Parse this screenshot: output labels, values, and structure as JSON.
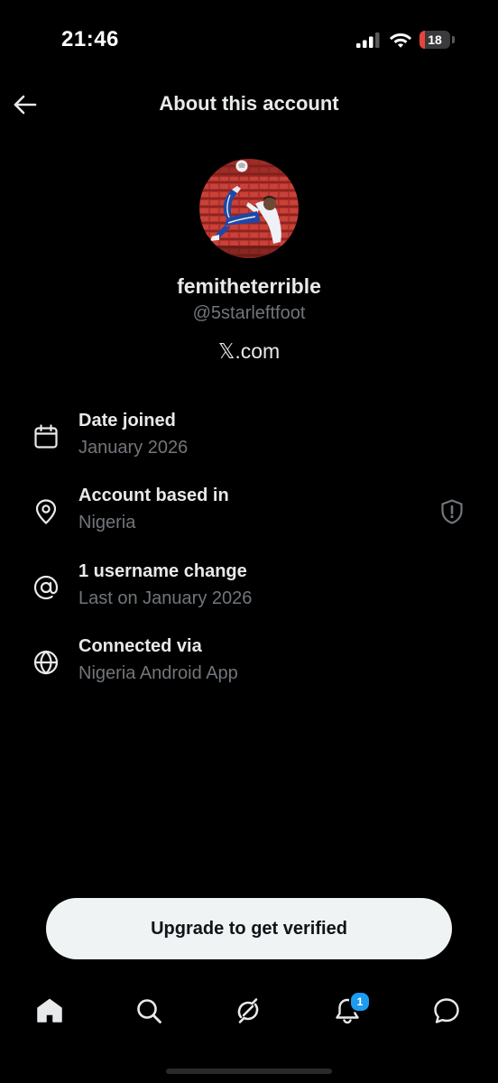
{
  "status_bar": {
    "time": "21:46",
    "battery_level": "18",
    "battery_fraction": 0.18
  },
  "header": {
    "title": "About this account",
    "back_icon": "arrow-left-icon"
  },
  "profile": {
    "display_name": "femitheterrible",
    "handle": "@5starleftfoot",
    "site": "𝕏.com"
  },
  "info_rows": [
    {
      "icon": "calendar-icon",
      "title": "Date joined",
      "value": "January 2026"
    },
    {
      "icon": "location-pin-icon",
      "title": "Account based in",
      "value": "Nigeria",
      "trailing_icon": "shield-alert-icon"
    },
    {
      "icon": "at-sign-icon",
      "title": "1 username change",
      "value": "Last on January 2026"
    },
    {
      "icon": "globe-icon",
      "title": "Connected via",
      "value": "Nigeria Android App"
    }
  ],
  "cta": {
    "label": "Upgrade to get verified"
  },
  "bottom_nav": {
    "items": [
      {
        "icon": "home-icon",
        "active": true
      },
      {
        "icon": "search-icon",
        "active": false
      },
      {
        "icon": "grok-icon",
        "active": false
      },
      {
        "icon": "bell-icon",
        "active": false,
        "badge": "1"
      },
      {
        "icon": "messages-icon",
        "active": false
      }
    ]
  },
  "colors": {
    "background": "#000000",
    "primary_text": "#e7e9ea",
    "secondary_text": "#71767b",
    "button_bg": "#eff3f4",
    "button_text": "#0f1419",
    "badge": "#1d9bf0",
    "battery_low": "#e5453a"
  }
}
